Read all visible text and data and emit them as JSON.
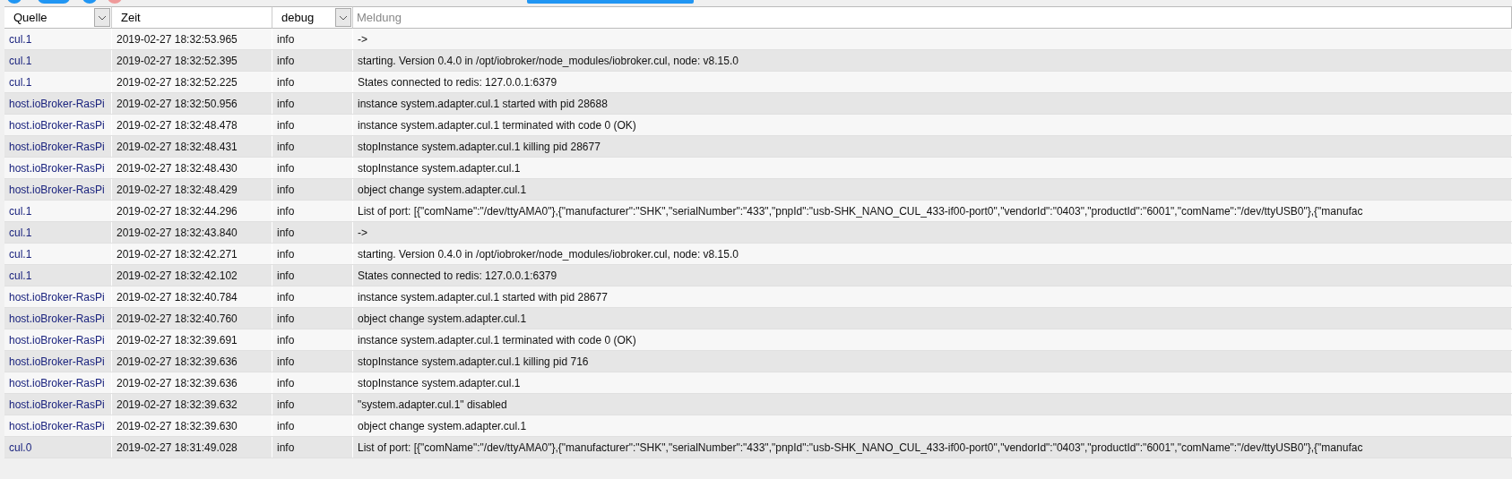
{
  "filters": {
    "source": {
      "value": "Quelle"
    },
    "time": {
      "value": "Zeit"
    },
    "severity": {
      "value": "debug"
    },
    "message": {
      "placeholder": "Meldung"
    }
  },
  "rows": [
    {
      "source": "cul.1",
      "time": "2019-02-27 18:32:53.965",
      "severity": "info",
      "message": "->"
    },
    {
      "source": "cul.1",
      "time": "2019-02-27 18:32:52.395",
      "severity": "info",
      "message": "starting. Version 0.4.0 in /opt/iobroker/node_modules/iobroker.cul, node: v8.15.0"
    },
    {
      "source": "cul.1",
      "time": "2019-02-27 18:32:52.225",
      "severity": "info",
      "message": "States connected to redis: 127.0.0.1:6379"
    },
    {
      "source": "host.ioBroker-RasPi",
      "time": "2019-02-27 18:32:50.956",
      "severity": "info",
      "message": "instance system.adapter.cul.1 started with pid 28688"
    },
    {
      "source": "host.ioBroker-RasPi",
      "time": "2019-02-27 18:32:48.478",
      "severity": "info",
      "message": "instance system.adapter.cul.1 terminated with code 0 (OK)"
    },
    {
      "source": "host.ioBroker-RasPi",
      "time": "2019-02-27 18:32:48.431",
      "severity": "info",
      "message": "stopInstance system.adapter.cul.1 killing pid 28677"
    },
    {
      "source": "host.ioBroker-RasPi",
      "time": "2019-02-27 18:32:48.430",
      "severity": "info",
      "message": "stopInstance system.adapter.cul.1"
    },
    {
      "source": "host.ioBroker-RasPi",
      "time": "2019-02-27 18:32:48.429",
      "severity": "info",
      "message": "object change system.adapter.cul.1"
    },
    {
      "source": "cul.1",
      "time": "2019-02-27 18:32:44.296",
      "severity": "info",
      "message": "List of port: [{\"comName\":\"/dev/ttyAMA0\"},{\"manufacturer\":\"SHK\",\"serialNumber\":\"433\",\"pnpId\":\"usb-SHK_NANO_CUL_433-if00-port0\",\"vendorId\":\"0403\",\"productId\":\"6001\",\"comName\":\"/dev/ttyUSB0\"},{\"manufac"
    },
    {
      "source": "cul.1",
      "time": "2019-02-27 18:32:43.840",
      "severity": "info",
      "message": "->"
    },
    {
      "source": "cul.1",
      "time": "2019-02-27 18:32:42.271",
      "severity": "info",
      "message": "starting. Version 0.4.0 in /opt/iobroker/node_modules/iobroker.cul, node: v8.15.0"
    },
    {
      "source": "cul.1",
      "time": "2019-02-27 18:32:42.102",
      "severity": "info",
      "message": "States connected to redis: 127.0.0.1:6379"
    },
    {
      "source": "host.ioBroker-RasPi",
      "time": "2019-02-27 18:32:40.784",
      "severity": "info",
      "message": "instance system.adapter.cul.1 started with pid 28677"
    },
    {
      "source": "host.ioBroker-RasPi",
      "time": "2019-02-27 18:32:40.760",
      "severity": "info",
      "message": "object change system.adapter.cul.1"
    },
    {
      "source": "host.ioBroker-RasPi",
      "time": "2019-02-27 18:32:39.691",
      "severity": "info",
      "message": "instance system.adapter.cul.1 terminated with code 0 (OK)"
    },
    {
      "source": "host.ioBroker-RasPi",
      "time": "2019-02-27 18:32:39.636",
      "severity": "info",
      "message": "stopInstance system.adapter.cul.1 killing pid 716"
    },
    {
      "source": "host.ioBroker-RasPi",
      "time": "2019-02-27 18:32:39.636",
      "severity": "info",
      "message": "stopInstance system.adapter.cul.1"
    },
    {
      "source": "host.ioBroker-RasPi",
      "time": "2019-02-27 18:32:39.632",
      "severity": "info",
      "message": "\"system.adapter.cul.1\" disabled"
    },
    {
      "source": "host.ioBroker-RasPi",
      "time": "2019-02-27 18:32:39.630",
      "severity": "info",
      "message": "object change system.adapter.cul.1"
    },
    {
      "source": "cul.0",
      "time": "2019-02-27 18:31:49.028",
      "severity": "info",
      "message": "List of port: [{\"comName\":\"/dev/ttyAMA0\"},{\"manufacturer\":\"SHK\",\"serialNumber\":\"433\",\"pnpId\":\"usb-SHK_NANO_CUL_433-if00-port0\",\"vendorId\":\"0403\",\"productId\":\"6001\",\"comName\":\"/dev/ttyUSB0\"},{\"manufac"
    }
  ]
}
